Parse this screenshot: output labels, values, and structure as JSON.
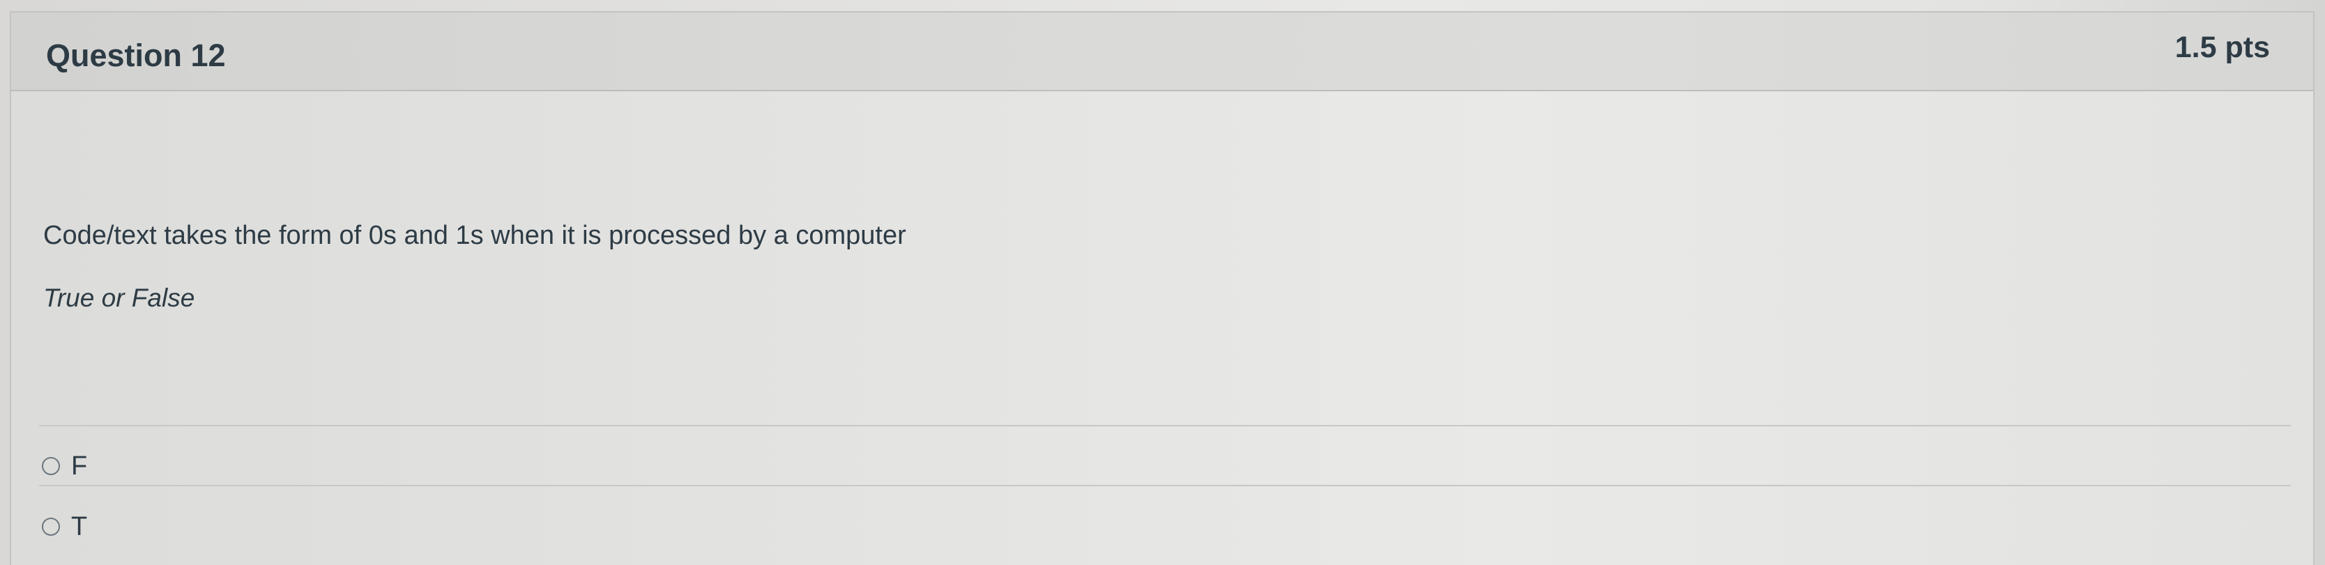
{
  "question": {
    "title": "Question 12",
    "points": "1.5 pts",
    "text": "Code/text takes the form of 0s and 1s when it is processed by a computer",
    "subtext": "True or False"
  },
  "answers": [
    {
      "label": "F",
      "selected": false
    },
    {
      "label": "T",
      "selected": false
    }
  ]
}
